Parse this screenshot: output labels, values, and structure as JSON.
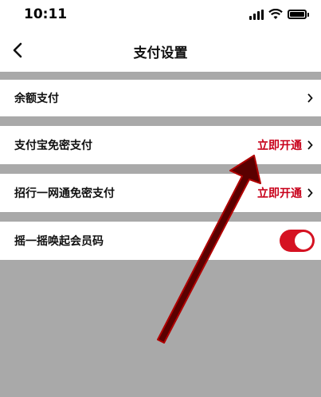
{
  "status_bar": {
    "time": "10:11"
  },
  "header": {
    "title": "支付设置",
    "back_icon": "chevron-left-icon"
  },
  "settings": {
    "items": [
      {
        "label": "余额支付",
        "action_label": ""
      },
      {
        "label": "支付宝免密支付",
        "action_label": "立即开通"
      },
      {
        "label": "招行一网通免密支付",
        "action_label": "立即开通"
      },
      {
        "label": "摇一摇唤起会员码",
        "toggle_on": true
      }
    ]
  },
  "colors": {
    "accent_red": "#c8001a",
    "toggle_on": "#d51222",
    "overlay_arrow": "#5a0000",
    "background_gray": "#a9a9a9"
  }
}
